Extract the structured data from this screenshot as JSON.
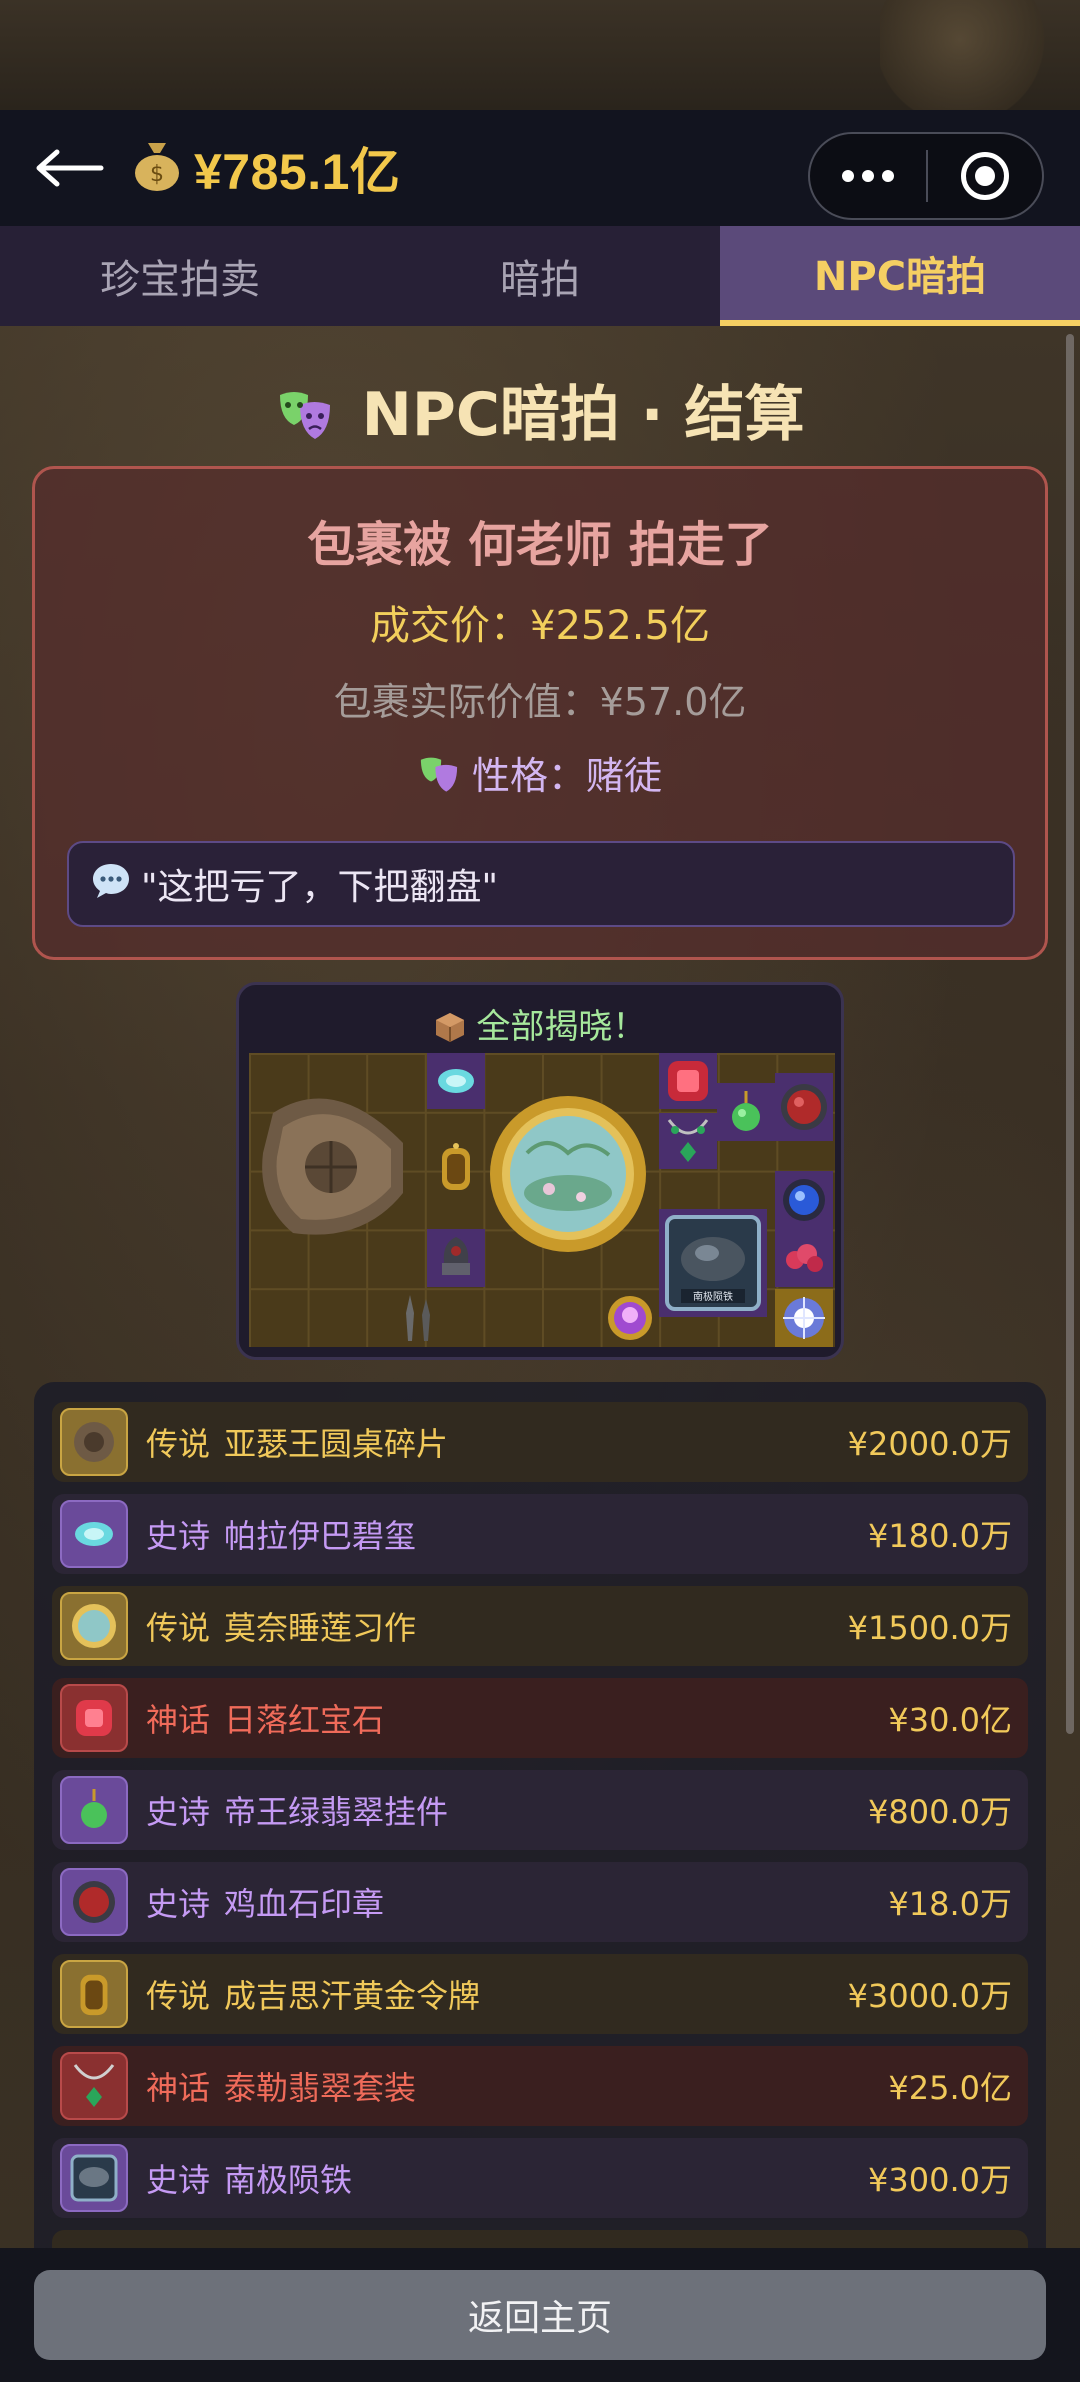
{
  "header": {
    "back_icon": "back-arrow-icon",
    "money_icon": "money-bag-icon",
    "balance": "¥785.1亿",
    "menu_icon": "more-dots-icon",
    "close_icon": "target-circle-icon"
  },
  "tabs": [
    {
      "label": "珍宝拍卖",
      "active": false
    },
    {
      "label": "暗拍",
      "active": false
    },
    {
      "label": "NPC暗拍",
      "active": true
    }
  ],
  "settlement": {
    "title": "NPC暗拍 · 结算",
    "title_icon": "theater-masks-icon",
    "winner_line": "包裹被 何老师 拍走了",
    "deal_price": "成交价：¥252.5亿",
    "actual_value": "包裹实际价值：¥57.0亿",
    "personality_icon": "theater-masks-icon",
    "personality": "性格：赌徒",
    "quote_icon": "speech-bubble-icon",
    "quote": "\"这把亏了，下把翻盘\""
  },
  "reveal": {
    "icon": "package-box-icon",
    "title": "全部揭晓！",
    "badge_text": "南极陨铁"
  },
  "items": [
    {
      "rarity": "传说",
      "name": "亚瑟王圆桌碎片",
      "price": "¥2000.0万",
      "tier": "legend",
      "icon": "round-table-fragment-icon"
    },
    {
      "rarity": "史诗",
      "name": "帕拉伊巴碧玺",
      "price": "¥180.0万",
      "tier": "epic",
      "icon": "paraiba-tourmaline-icon"
    },
    {
      "rarity": "传说",
      "name": "莫奈睡莲习作",
      "price": "¥1500.0万",
      "tier": "legend",
      "icon": "monet-painting-icon"
    },
    {
      "rarity": "神话",
      "name": "日落红宝石",
      "price": "¥30.0亿",
      "tier": "myth",
      "icon": "ruby-icon"
    },
    {
      "rarity": "史诗",
      "name": "帝王绿翡翠挂件",
      "price": "¥800.0万",
      "tier": "epic",
      "icon": "jade-pendant-icon"
    },
    {
      "rarity": "史诗",
      "name": "鸡血石印章",
      "price": "¥18.0万",
      "tier": "epic",
      "icon": "bloodstone-seal-icon"
    },
    {
      "rarity": "传说",
      "name": "成吉思汗黄金令牌",
      "price": "¥3000.0万",
      "tier": "legend",
      "icon": "gold-tablet-icon"
    },
    {
      "rarity": "神话",
      "name": "泰勒翡翠套装",
      "price": "¥25.0亿",
      "tier": "myth",
      "icon": "emerald-set-icon"
    },
    {
      "rarity": "史诗",
      "name": "南极陨铁",
      "price": "¥300.0万",
      "tier": "epic",
      "icon": "meteorite-icon"
    }
  ],
  "footer": {
    "home_label": "返回主页"
  },
  "colors": {
    "gold": "#f2c84b",
    "legend": "#f1c95a",
    "epic": "#c59af4",
    "myth": "#f06b5a",
    "tab_active_bg": "#5b4a7a"
  }
}
